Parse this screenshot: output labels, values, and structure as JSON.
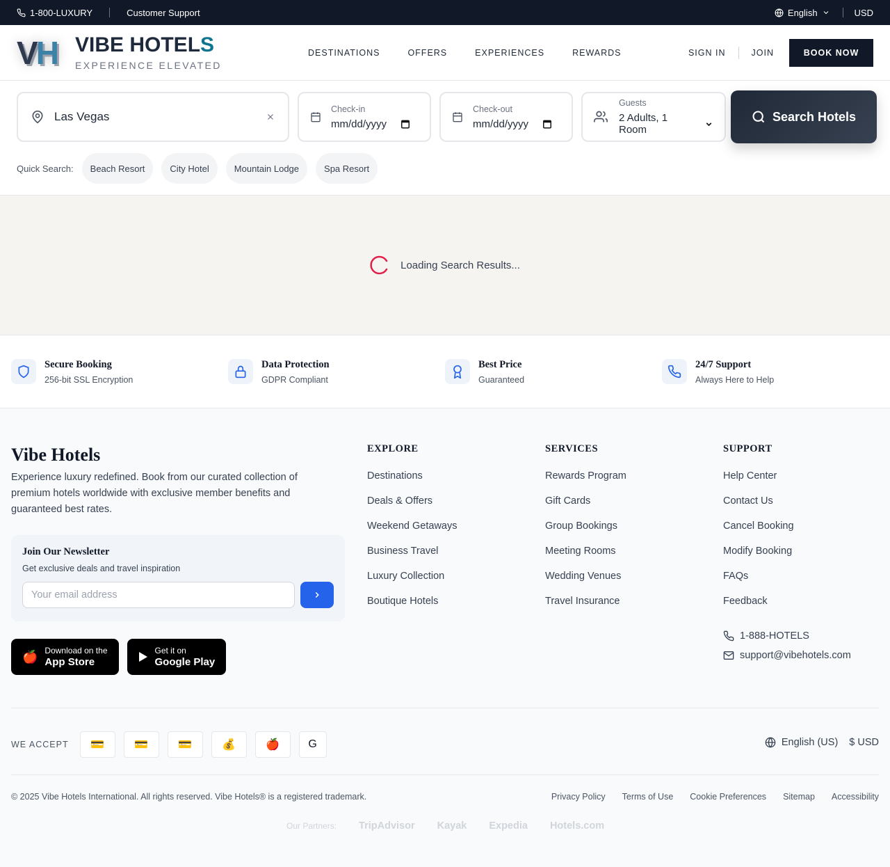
{
  "topbar": {
    "phone": "1-800-LUXURY",
    "support": "Customer Support",
    "language": "English",
    "currency": "USD"
  },
  "header": {
    "logo_mark_v": "V",
    "logo_mark_h": "H",
    "brand_main": "VIBE HOTEL",
    "brand_accent": "S",
    "tagline": "EXPERIENCE ELEVATED",
    "nav": [
      "DESTINATIONS",
      "OFFERS",
      "EXPERIENCES",
      "REWARDS"
    ],
    "sign_in": "SIGN IN",
    "join": "JOIN",
    "book_now": "BOOK NOW"
  },
  "search": {
    "destination": "Las Vegas",
    "checkin_label": "Check-in",
    "checkin_value": "mm/dd/yyyy",
    "checkout_label": "Check-out",
    "checkout_value": "mm/dd/yyyy",
    "guests_label": "Guests",
    "guests_value": "2 Adults, 1 Room",
    "button": "Search Hotels",
    "quick_label": "Quick Search:",
    "quick_chips": [
      "Beach Resort",
      "City Hotel",
      "Mountain Lodge",
      "Spa Resort"
    ]
  },
  "loading": {
    "text": "Loading Search Results...",
    "spinner_color": "#e11d48"
  },
  "trust": [
    {
      "title": "Secure Booking",
      "sub": "256-bit SSL Encryption",
      "icon": "shield-icon"
    },
    {
      "title": "Data Protection",
      "sub": "GDPR Compliant",
      "icon": "lock-icon"
    },
    {
      "title": "Best Price",
      "sub": "Guaranteed",
      "icon": "award-icon"
    },
    {
      "title": "24/7 Support",
      "sub": "Always Here to Help",
      "icon": "phone-icon"
    }
  ],
  "footer": {
    "brand": "Vibe Hotels",
    "description": "Experience luxury redefined. Book from our curated collection of premium hotels worldwide with exclusive member benefits and guaranteed best rates.",
    "newsletter_title": "Join Our Newsletter",
    "newsletter_sub": "Get exclusive deals and travel inspiration",
    "email_placeholder": "Your email address",
    "app_store_small": "Download on the",
    "app_store_big": "App Store",
    "play_small": "Get it on",
    "play_big": "Google Play",
    "explore_title": "EXPLORE",
    "explore": [
      "Destinations",
      "Deals & Offers",
      "Weekend Getaways",
      "Business Travel",
      "Luxury Collection",
      "Boutique Hotels"
    ],
    "services_title": "SERVICES",
    "services": [
      "Rewards Program",
      "Gift Cards",
      "Group Bookings",
      "Meeting Rooms",
      "Wedding Venues",
      "Travel Insurance"
    ],
    "support_title": "SUPPORT",
    "support": [
      "Help Center",
      "Contact Us",
      "Cancel Booking",
      "Modify Booking",
      "FAQs",
      "Feedback"
    ],
    "contact_phone": "1-888-HOTELS",
    "contact_email": "support@vibehotels.com",
    "we_accept": "WE ACCEPT",
    "payment_icons": [
      "💳",
      "💳",
      "💳",
      "💰",
      "🍎",
      "G"
    ],
    "locale": "English (US)",
    "currency": "$ USD",
    "copyright": "© 2025 Vibe Hotels International. All rights reserved. Vibe Hotels® is a registered trademark.",
    "legal": [
      "Privacy Policy",
      "Terms of Use",
      "Cookie Preferences",
      "Sitemap",
      "Accessibility"
    ],
    "partners_label": "Our Partners:",
    "partners": [
      "TripAdvisor",
      "Kayak",
      "Expedia",
      "Hotels.com"
    ]
  }
}
